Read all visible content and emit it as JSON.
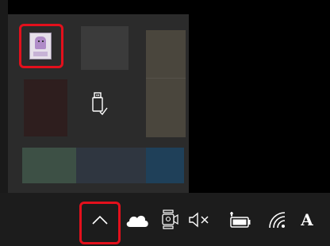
{
  "flyout": {
    "tiles": [
      {
        "id": "app-icon",
        "color": "#2b2b2b"
      },
      {
        "id": "dark-gray",
        "color": "#3b3b3b"
      },
      {
        "id": "tall-brown",
        "color": "#4a463d"
      },
      {
        "id": "dark-red",
        "color": "#2e1e1e"
      },
      {
        "id": "usb",
        "icon": "usb-drive-icon"
      },
      {
        "id": "green",
        "color": "#3d5045"
      },
      {
        "id": "slate",
        "color": "#2f3640"
      },
      {
        "id": "blue",
        "color": "#1f4059"
      }
    ]
  },
  "taskbar": {
    "icons": [
      "chevron-up-icon",
      "onedrive-cloud-icon",
      "meet-now-icon",
      "volume-muted-icon",
      "battery-icon",
      "wifi-icon"
    ],
    "ime_label": "A"
  },
  "colors": {
    "highlight": "#e3101c",
    "taskbar_bg": "#1c1c1c",
    "flyout_bg": "#2b2b2b",
    "icon": "#ffffff"
  }
}
